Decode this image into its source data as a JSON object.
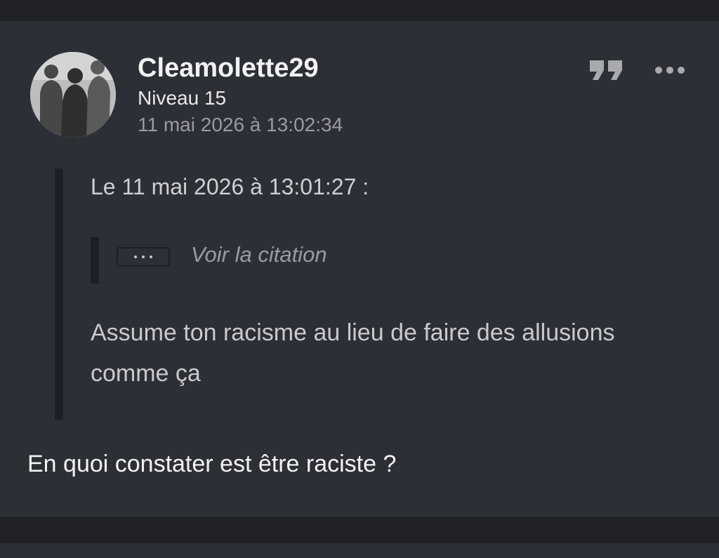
{
  "post": {
    "author": "Cleamolette29",
    "level": "Niveau 15",
    "timestamp": "11 mai 2026 à 13:02:34",
    "actions": {
      "quote_icon": "quote-icon",
      "more_icon": "more-icon"
    },
    "quote": {
      "header": "Le 11 mai 2026 à 13:01:27 :",
      "nested_quote_label": "Voir la citation",
      "text": "Assume ton racisme au lieu de faire des allusions comme ça"
    },
    "body": "En quoi constater est être raciste ?"
  },
  "colors": {
    "background": "#202226",
    "post_background": "#2d2f37",
    "quote_bar": "#1d1f24",
    "text_primary": "#f2f2f2",
    "text_muted": "#9a9ba0"
  }
}
